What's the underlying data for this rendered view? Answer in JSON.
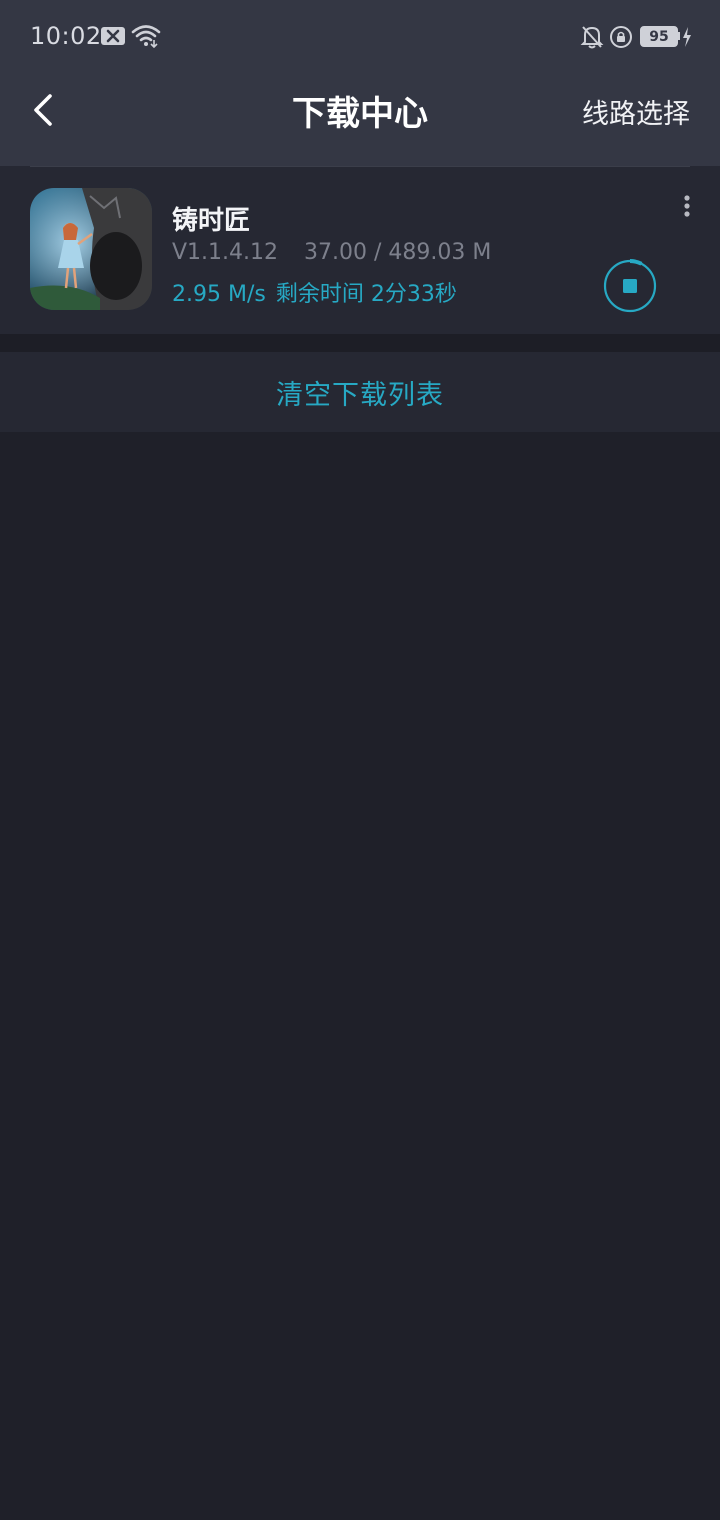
{
  "status_bar": {
    "time": "10:02",
    "battery": "95",
    "icons": [
      "notification-x-icon",
      "wifi-icon",
      "bell-off-icon",
      "rotation-lock-icon",
      "charging-icon"
    ]
  },
  "header": {
    "title": "下载中心",
    "route_select_label": "线路选择",
    "back_icon": "chevron-left-icon"
  },
  "download": {
    "app_name": "铸时匠",
    "version": "V1.1.4.12",
    "size_progress": "37.00 / 489.03 M",
    "speed": "2.95 M/s",
    "remaining": "剩余时间 2分33秒",
    "progress_fraction": 0.0757,
    "more_icon": "more-vertical-icon",
    "stop_icon": "stop-download-icon"
  },
  "actions": {
    "clear_list_label": "清空下载列表"
  },
  "colors": {
    "accent": "#27a9c4",
    "header_bg": "#343744",
    "page_bg": "#1f2029",
    "card_bg": "#262833"
  }
}
